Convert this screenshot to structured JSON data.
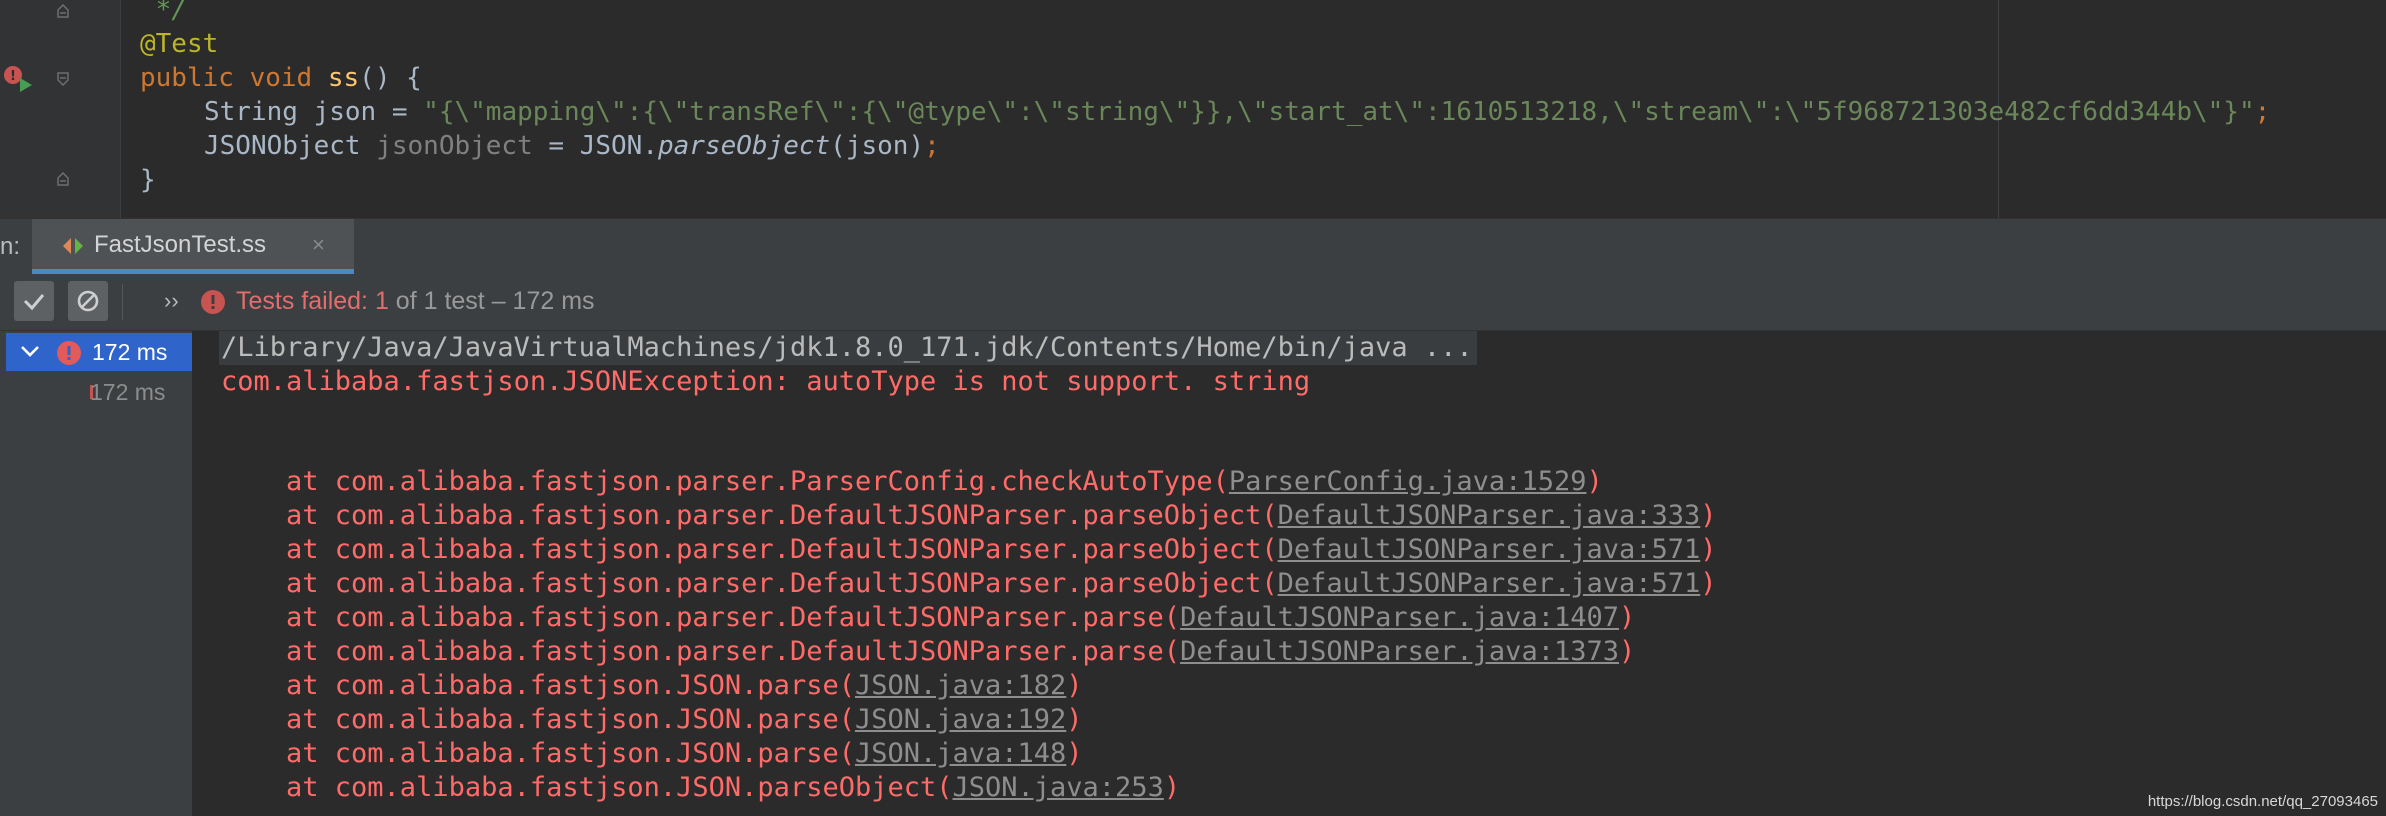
{
  "editor": {
    "comment_end": " */",
    "annotation": "@Test",
    "signature": {
      "public": "public",
      "void": "void",
      "method": "ss",
      "rest": "() {"
    },
    "line3": {
      "type": "String",
      "var": "json",
      "eq": " = ",
      "string": "\"{\\\"mapping\\\":{\\\"transRef\\\":{\\\"@type\\\":\\\"string\\\"}},\\\"start_at\\\":1610513218,\\\"stream\\\":\\\"5f968721303e482cf6dd344b\\\"}\"",
      "semi": ";"
    },
    "line4": {
      "type": "JSONObject",
      "var": "jsonObject",
      "eq": " = JSON.",
      "method": "parseObject",
      "args": "(json)",
      "semi": ";"
    },
    "closing": "}"
  },
  "run_panel": {
    "prefix": "n:",
    "tab_label": "FastJsonTest.ss",
    "tab_close": "×"
  },
  "toolbar": {
    "more": "››",
    "status_failed": "Tests failed: 1",
    "status_suffix": " of 1 test – 172 ms"
  },
  "test_tree": {
    "root_time": "172 ms",
    "child_time": "172 ms"
  },
  "console": {
    "command": "/Library/Java/JavaVirtualMachines/jdk1.8.0_171.jdk/Contents/Home/bin/java ...",
    "exception": "com.alibaba.fastjson.JSONException: autoType is not support. string",
    "stack": [
      {
        "at": "    at com.alibaba.fastjson.parser.ParserConfig.checkAutoType(",
        "link": "ParserConfig.java:1529",
        "end": ")"
      },
      {
        "at": "    at com.alibaba.fastjson.parser.DefaultJSONParser.parseObject(",
        "link": "DefaultJSONParser.java:333",
        "end": ")"
      },
      {
        "at": "    at com.alibaba.fastjson.parser.DefaultJSONParser.parseObject(",
        "link": "DefaultJSONParser.java:571",
        "end": ")"
      },
      {
        "at": "    at com.alibaba.fastjson.parser.DefaultJSONParser.parseObject(",
        "link": "DefaultJSONParser.java:571",
        "end": ")"
      },
      {
        "at": "    at com.alibaba.fastjson.parser.DefaultJSONParser.parse(",
        "link": "DefaultJSONParser.java:1407",
        "end": ")"
      },
      {
        "at": "    at com.alibaba.fastjson.parser.DefaultJSONParser.parse(",
        "link": "DefaultJSONParser.java:1373",
        "end": ")"
      },
      {
        "at": "    at com.alibaba.fastjson.JSON.parse(",
        "link": "JSON.java:182",
        "end": ")"
      },
      {
        "at": "    at com.alibaba.fastjson.JSON.parse(",
        "link": "JSON.java:192",
        "end": ")"
      },
      {
        "at": "    at com.alibaba.fastjson.JSON.parse(",
        "link": "JSON.java:148",
        "end": ")"
      },
      {
        "at": "    at com.alibaba.fastjson.JSON.parseObject(",
        "link": "JSON.java:253",
        "end": ")"
      }
    ]
  },
  "watermark": "https://blog.csdn.net/qq_27093465",
  "colors": {
    "editor_bg": "#2b2b2b",
    "panel_bg": "#3c3f41",
    "error_red": "#ff6b68",
    "selection_blue": "#2f65ca",
    "tab_underline": "#4a88c7"
  },
  "icons": [
    "fold-marker-icon",
    "run-test-gutter-icon",
    "java-class-icon",
    "check-icon",
    "cancel-icon",
    "error-icon",
    "chevron-down-icon"
  ]
}
